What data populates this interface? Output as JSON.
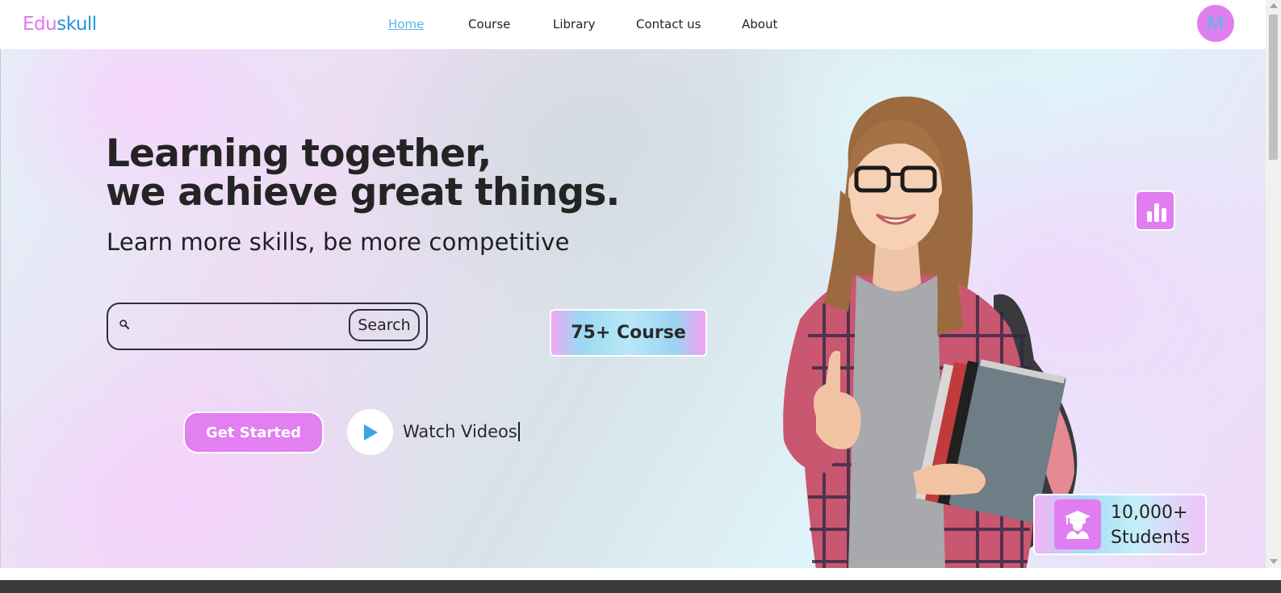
{
  "brand": {
    "part1": "Edu",
    "part2": "skull",
    "color1": "#e277f2",
    "color2": "#2596d9"
  },
  "nav": {
    "items": [
      {
        "label": "Home",
        "active": true
      },
      {
        "label": "Course",
        "active": false
      },
      {
        "label": "Library",
        "active": false
      },
      {
        "label": "Contact us",
        "active": false
      },
      {
        "label": "About",
        "active": false
      }
    ]
  },
  "user": {
    "initial": "M",
    "avatar_color": "#e07ff0"
  },
  "hero": {
    "title_line1": "Learning together,",
    "title_line2": "we achieve great things.",
    "subtitle": "Learn more skills, be more competitive",
    "search": {
      "placeholder": "",
      "value": "",
      "button_label": "Search"
    },
    "course_badge": "75+ Course",
    "cta": {
      "get_started": "Get Started",
      "watch_videos": "Watch Videos"
    },
    "students": {
      "count": "10,000+",
      "label": "Students"
    }
  },
  "icons": {
    "search": "search-icon",
    "play": "play-icon",
    "stats": "bar-chart-icon",
    "graduate": "graduate-icon"
  },
  "colors": {
    "accent_pink": "#e07ff0",
    "accent_blue": "#2596d9",
    "link_active": "#5db4e8"
  }
}
